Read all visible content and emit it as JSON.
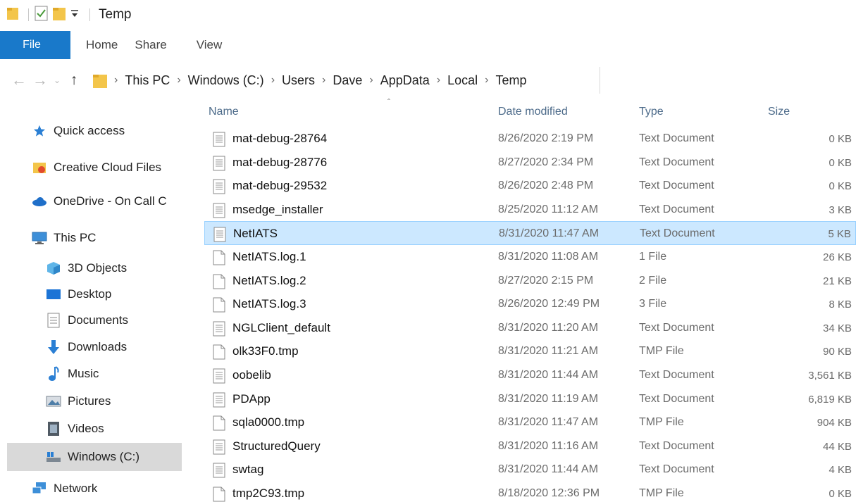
{
  "window": {
    "title": "Temp"
  },
  "ribbon": {
    "tabs": [
      "File",
      "Home",
      "Share",
      "View"
    ]
  },
  "address": {
    "crumbs": [
      "This PC",
      "Windows (C:)",
      "Users",
      "Dave",
      "AppData",
      "Local",
      "Temp"
    ]
  },
  "nav": {
    "items": [
      {
        "label": "Quick access",
        "icon": "star-icon"
      },
      {
        "label": "Creative Cloud Files",
        "icon": "creative-cloud-icon"
      },
      {
        "label": "OneDrive - On Call C",
        "icon": "onedrive-cloud-icon"
      },
      {
        "label": "This PC",
        "icon": "computer-icon"
      },
      {
        "label": "3D Objects",
        "icon": "3d-objects-icon"
      },
      {
        "label": "Desktop",
        "icon": "desktop-icon"
      },
      {
        "label": "Documents",
        "icon": "documents-icon"
      },
      {
        "label": "Downloads",
        "icon": "downloads-icon"
      },
      {
        "label": "Music",
        "icon": "music-icon"
      },
      {
        "label": "Pictures",
        "icon": "pictures-icon"
      },
      {
        "label": "Videos",
        "icon": "videos-icon"
      },
      {
        "label": "Windows (C:)",
        "icon": "drive-icon"
      },
      {
        "label": "Network",
        "icon": "network-icon"
      }
    ],
    "selected": "Windows (C:)"
  },
  "columns": {
    "name": "Name",
    "date": "Date modified",
    "type": "Type",
    "size": "Size"
  },
  "files": [
    {
      "name": "mat-debug-28764",
      "date": "8/26/2020 2:19 PM",
      "type": "Text Document",
      "size": "0 KB",
      "icon": "text-file-icon"
    },
    {
      "name": "mat-debug-28776",
      "date": "8/27/2020 2:34 PM",
      "type": "Text Document",
      "size": "0 KB",
      "icon": "text-file-icon"
    },
    {
      "name": "mat-debug-29532",
      "date": "8/26/2020 2:48 PM",
      "type": "Text Document",
      "size": "0 KB",
      "icon": "text-file-icon"
    },
    {
      "name": "msedge_installer",
      "date": "8/25/2020 11:12 AM",
      "type": "Text Document",
      "size": "3 KB",
      "icon": "text-file-icon"
    },
    {
      "name": "NetIATS",
      "date": "8/31/2020 11:47 AM",
      "type": "Text Document",
      "size": "5 KB",
      "icon": "text-file-icon",
      "selected": true
    },
    {
      "name": "NetIATS.log.1",
      "date": "8/31/2020 11:08 AM",
      "type": "1 File",
      "size": "26 KB",
      "icon": "blank-file-icon"
    },
    {
      "name": "NetIATS.log.2",
      "date": "8/27/2020 2:15 PM",
      "type": "2 File",
      "size": "21 KB",
      "icon": "blank-file-icon"
    },
    {
      "name": "NetIATS.log.3",
      "date": "8/26/2020 12:49 PM",
      "type": "3 File",
      "size": "8 KB",
      "icon": "blank-file-icon"
    },
    {
      "name": "NGLClient_default",
      "date": "8/31/2020 11:20 AM",
      "type": "Text Document",
      "size": "34 KB",
      "icon": "text-file-icon"
    },
    {
      "name": "olk33F0.tmp",
      "date": "8/31/2020 11:21 AM",
      "type": "TMP File",
      "size": "90 KB",
      "icon": "blank-file-icon"
    },
    {
      "name": "oobelib",
      "date": "8/31/2020 11:44 AM",
      "type": "Text Document",
      "size": "3,561 KB",
      "icon": "text-file-icon"
    },
    {
      "name": "PDApp",
      "date": "8/31/2020 11:19 AM",
      "type": "Text Document",
      "size": "6,819 KB",
      "icon": "text-file-icon"
    },
    {
      "name": "sqla0000.tmp",
      "date": "8/31/2020 11:47 AM",
      "type": "TMP File",
      "size": "904 KB",
      "icon": "blank-file-icon"
    },
    {
      "name": "StructuredQuery",
      "date": "8/31/2020 11:16 AM",
      "type": "Text Document",
      "size": "44 KB",
      "icon": "text-file-icon"
    },
    {
      "name": "swtag",
      "date": "8/31/2020 11:44 AM",
      "type": "Text Document",
      "size": "4 KB",
      "icon": "text-file-icon"
    },
    {
      "name": "tmp2C93.tmp",
      "date": "8/18/2020 12:36 PM",
      "type": "TMP File",
      "size": "0 KB",
      "icon": "blank-file-icon"
    }
  ],
  "colors": {
    "accent": "#1979ca",
    "selection": "#cce8ff",
    "selection_border": "#99d1ff",
    "nav_selected": "#d9d9d9"
  }
}
